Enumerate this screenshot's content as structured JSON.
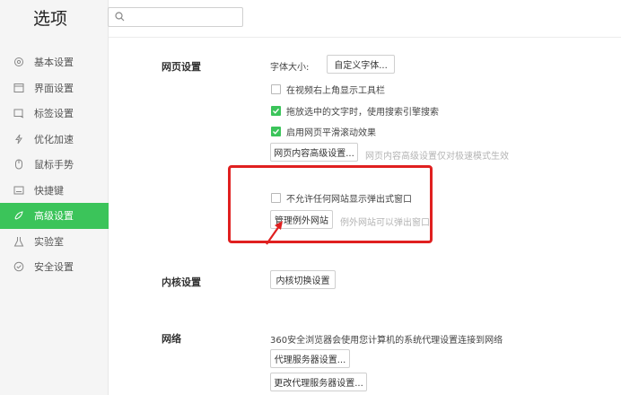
{
  "window": {
    "title": "选项"
  },
  "search": {
    "placeholder": ""
  },
  "sidebar": {
    "items": [
      {
        "label": "基本设置",
        "icon": "gear-icon"
      },
      {
        "label": "界面设置",
        "icon": "window-icon"
      },
      {
        "label": "标签设置",
        "icon": "tag-icon"
      },
      {
        "label": "优化加速",
        "icon": "lightning-icon"
      },
      {
        "label": "鼠标手势",
        "icon": "mouse-icon"
      },
      {
        "label": "快捷键",
        "icon": "keyboard-icon"
      },
      {
        "label": "高级设置",
        "icon": "advanced-icon",
        "active": true
      },
      {
        "label": "实验室",
        "icon": "flask-icon"
      },
      {
        "label": "安全设置",
        "icon": "shield-icon"
      }
    ]
  },
  "web_settings": {
    "title": "网页设置",
    "font_size_label": "字体大小:",
    "custom_font_button": "自定义字体...",
    "checkbox_toolbar": {
      "label": "在视频右上角显示工具栏",
      "checked": false
    },
    "checkbox_search": {
      "label": "拖放选中的文字时，使用搜索引擎搜索",
      "checked": true
    },
    "checkbox_smooth": {
      "label": "启用网页平滑滚动效果",
      "checked": true
    },
    "content_advanced_button": "网页内容高级设置...",
    "content_advanced_hint": "网页内容高级设置仅对极速模式生效",
    "checkbox_popup": {
      "label": "不允许任何网站显示弹出式窗口",
      "checked": false
    },
    "manage_exceptions_button": "管理例外网站",
    "manage_exceptions_hint": "例外网站可以弹出窗口"
  },
  "kernel_settings": {
    "title": "内核设置",
    "switch_button": "内核切换设置"
  },
  "network": {
    "title": "网络",
    "description": "360安全浏览器会使用您计算机的系统代理设置连接到网络",
    "proxy_button": "代理服务器设置...",
    "change_proxy_button": "更改代理服务器设置..."
  },
  "colors": {
    "accent": "#3bc45a",
    "highlight": "#e02020"
  }
}
